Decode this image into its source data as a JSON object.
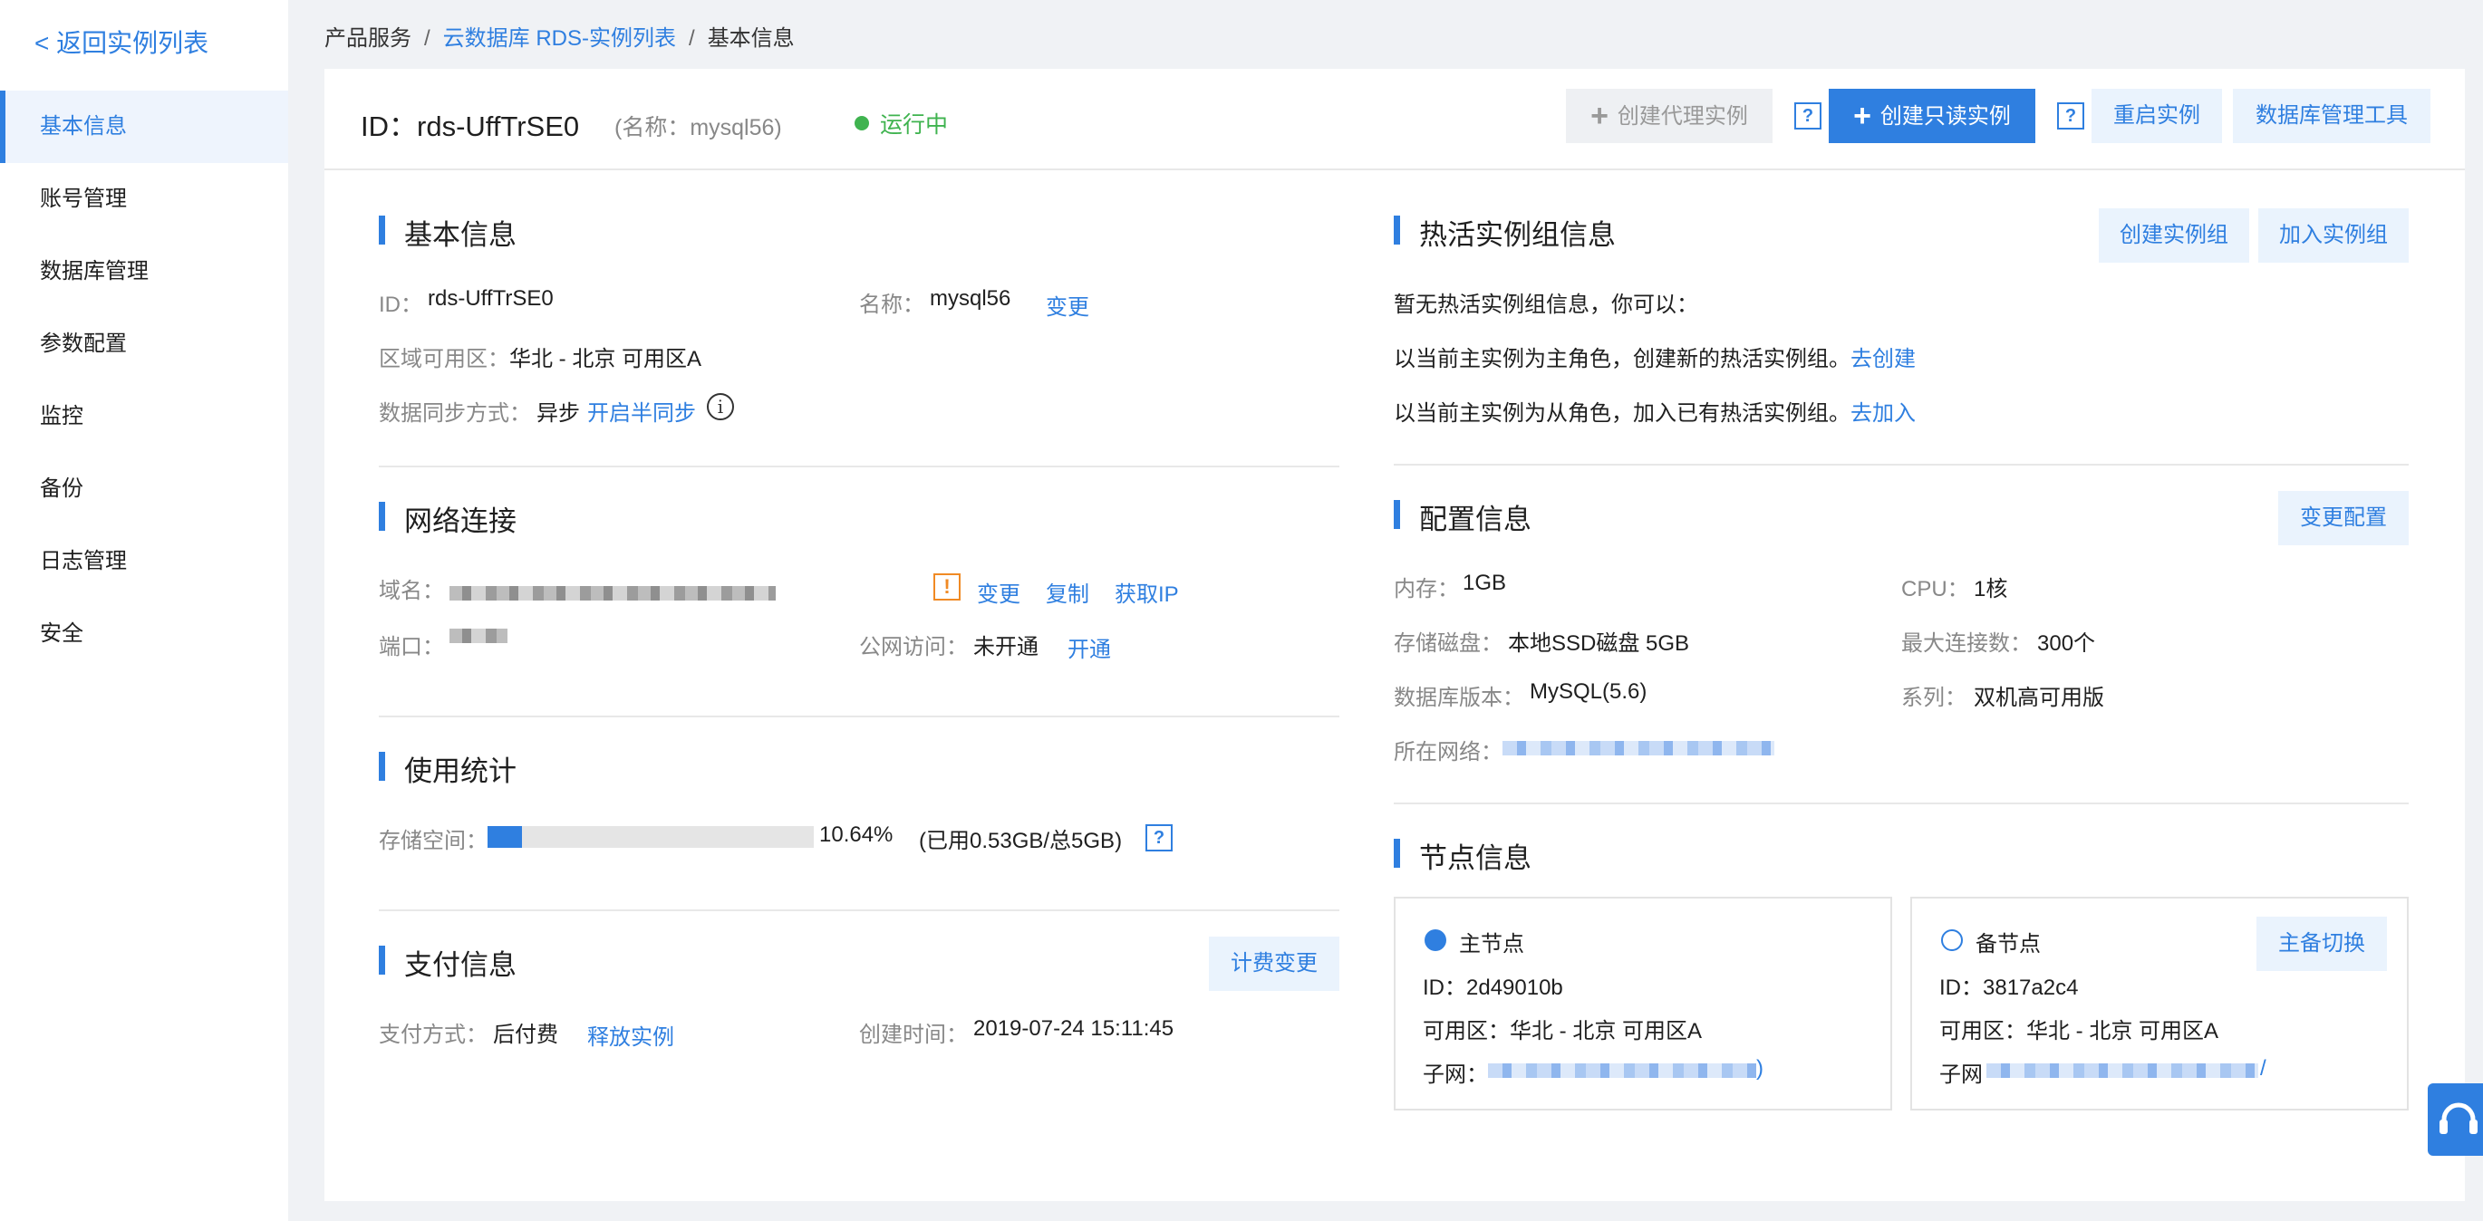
{
  "sidebar": {
    "back": "< 返回实例列表",
    "items": [
      "基本信息",
      "账号管理",
      "数据库管理",
      "参数配置",
      "监控",
      "备份",
      "日志管理",
      "安全"
    ]
  },
  "breadcrumb": {
    "root": "产品服务",
    "sep": "/",
    "list": "云数据库 RDS-实例列表",
    "current": "基本信息"
  },
  "header": {
    "id": "ID：rds-UffTrSE0",
    "name": "(名称：mysql56)",
    "status": "运行中",
    "btn_proxy": "创建代理实例",
    "btn_readonly": "创建只读实例",
    "btn_restart": "重启实例",
    "btn_dbtool": "数据库管理工具",
    "help": "?"
  },
  "basic": {
    "title": "基本信息",
    "id_label": "ID：",
    "id_value": "rds-UffTrSE0",
    "name_label": "名称：",
    "name_value": "mysql56",
    "name_change": "变更",
    "zone_label": "区域可用区：",
    "zone_value": "华北 - 北京 可用区A",
    "sync_label": "数据同步方式：",
    "sync_value": "异步",
    "sync_link": "开启半同步",
    "info": "i"
  },
  "network": {
    "title": "网络连接",
    "domain_label": "域名：",
    "warn": "!",
    "change": "变更",
    "copy": "复制",
    "get_ip": "获取IP",
    "port_label": "端口：",
    "public_label": "公网访问：",
    "public_value": "未开通",
    "open": "开通"
  },
  "usage": {
    "title": "使用统计",
    "storage_label": "存储空间：",
    "percent": "10.64%",
    "progress_fraction": 0.1064,
    "detail": "(已用0.53GB/总5GB)",
    "help": "?"
  },
  "payment": {
    "title": "支付信息",
    "change_btn": "计费变更",
    "method_label": "支付方式：",
    "method_value": "后付费",
    "release": "释放实例",
    "created_label": "创建时间：",
    "created_value": "2019-07-24 15:11:45"
  },
  "hot": {
    "title": "热活实例组信息",
    "btn_create": "创建实例组",
    "btn_join": "加入实例组",
    "empty": "暂无热活实例组信息，你可以：",
    "line1": "以当前主实例为主角色，创建新的热活实例组。",
    "line1_link": "去创建",
    "line2": "以当前主实例为从角色，加入已有热活实例组。",
    "line2_link": "去加入"
  },
  "config": {
    "title": "配置信息",
    "btn": "变更配置",
    "mem_label": "内存：",
    "mem_value": "1GB",
    "cpu_label": "CPU：",
    "cpu_value": "1核",
    "disk_label": "存储磁盘：",
    "disk_value": "本地SSD磁盘 5GB",
    "maxconn_label": "最大连接数：",
    "maxconn_value": "300个",
    "ver_label": "数据库版本：",
    "ver_value": "MySQL(5.6)",
    "series_label": "系列：",
    "series_value": "双机高可用版",
    "net_label": "所在网络："
  },
  "nodes": {
    "title": "节点信息",
    "master": {
      "title": "主节点",
      "id": "ID：2d49010b",
      "zone": "可用区：华北 - 北京 可用区A",
      "subnet": "子网：",
      "tail": ")"
    },
    "slave": {
      "title": "备节点",
      "id": "ID：3817a2c4",
      "zone": "可用区：华北 - 北京 可用区A",
      "subnet": "子网",
      "tail": "/",
      "switch": "主备切换"
    }
  },
  "colors": {
    "accent": "#2f7fe0",
    "running": "#3fb34f",
    "warning": "#f08a24"
  }
}
